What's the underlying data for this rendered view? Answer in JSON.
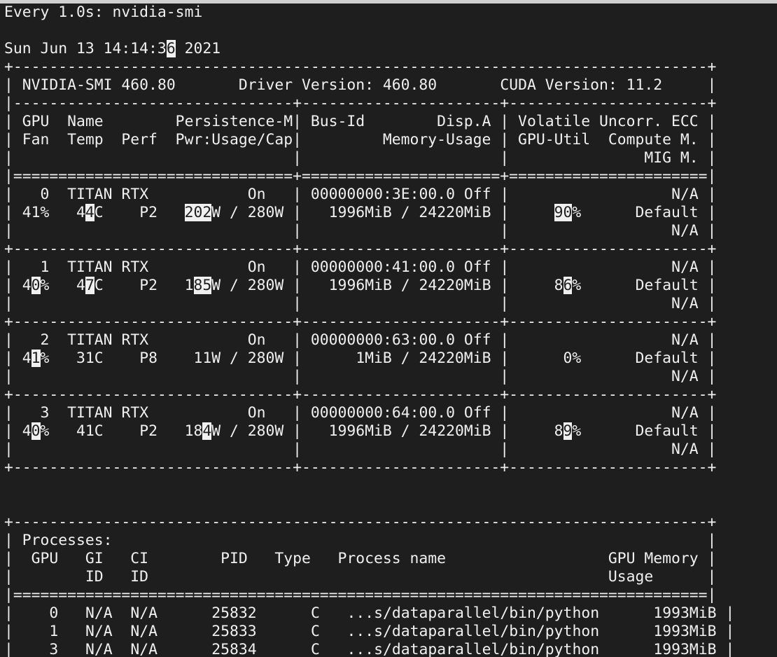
{
  "terminal": {
    "header_line": "Every 1.0s: nvidia-smi",
    "timestamp": "Sun Jun 13 14:14:36 2021",
    "highlighted_chars": [
      "6",
      "202",
      "4",
      "90",
      "0",
      "7",
      "85",
      "6",
      "1",
      "0",
      "4",
      "9"
    ]
  },
  "smi": {
    "smi_version_label": "NVIDIA-SMI 460.80",
    "driver_version_label": "Driver Version: 460.80",
    "cuda_version_label": "CUDA Version: 11.2"
  },
  "gpu_table": {
    "header": {
      "line1": "| GPU  Name        Persistence-M| Bus-Id        Disp.A | Volatile Uncorr. ECC |",
      "line2": "| Fan  Temp  Perf  Pwr:Usage/Cap|         Memory-Usage | GPU-Util  Compute M. |",
      "line3": "|                               |                      |               MIG M. |"
    },
    "gpus": [
      {
        "index": "0",
        "name": "TITAN RTX",
        "persistence": "On",
        "bus_id": "00000000:3E:00.0",
        "disp": "Off",
        "ecc": "N/A",
        "fan": "41%",
        "temp": "44C",
        "perf": "P2",
        "power": "202W / 280W",
        "memory": "1996MiB / 24220MiB",
        "util": "90%",
        "compute": "Default",
        "mig": "N/A"
      },
      {
        "index": "1",
        "name": "TITAN RTX",
        "persistence": "On",
        "bus_id": "00000000:41:00.0",
        "disp": "Off",
        "ecc": "N/A",
        "fan": "40%",
        "temp": "47C",
        "perf": "P2",
        "power": "185W / 280W",
        "memory": "1996MiB / 24220MiB",
        "util": "86%",
        "compute": "Default",
        "mig": "N/A"
      },
      {
        "index": "2",
        "name": "TITAN RTX",
        "persistence": "On",
        "bus_id": "00000000:63:00.0",
        "disp": "Off",
        "ecc": "N/A",
        "fan": "41%",
        "temp": "31C",
        "perf": "P8",
        "power": "11W / 280W",
        "memory": "1MiB / 24220MiB",
        "util": "0%",
        "compute": "Default",
        "mig": "N/A"
      },
      {
        "index": "3",
        "name": "TITAN RTX",
        "persistence": "On",
        "bus_id": "00000000:64:00.0",
        "disp": "Off",
        "ecc": "N/A",
        "fan": "40%",
        "temp": "41C",
        "perf": "P2",
        "power": "184W / 280W",
        "memory": "1996MiB / 24220MiB",
        "util": "89%",
        "compute": "Default",
        "mig": "N/A"
      }
    ]
  },
  "processes": {
    "title": "Processes:",
    "header_line1": "|  GPU   GI   CI        PID   Type   Process name                  GPU Memory |",
    "header_line2": "|        ID   ID                                                   Usage      |",
    "rows": [
      {
        "gpu": "0",
        "gi": "N/A",
        "ci": "N/A",
        "pid": "25832",
        "type": "C",
        "name": "...s/dataparallel/bin/python",
        "mem": "1993MiB"
      },
      {
        "gpu": "1",
        "gi": "N/A",
        "ci": "N/A",
        "pid": "25833",
        "type": "C",
        "name": "...s/dataparallel/bin/python",
        "mem": "1993MiB"
      },
      {
        "gpu": "3",
        "gi": "N/A",
        "ci": "N/A",
        "pid": "25834",
        "type": "C",
        "name": "...s/dataparallel/bin/python",
        "mem": "1993MiB"
      }
    ]
  }
}
